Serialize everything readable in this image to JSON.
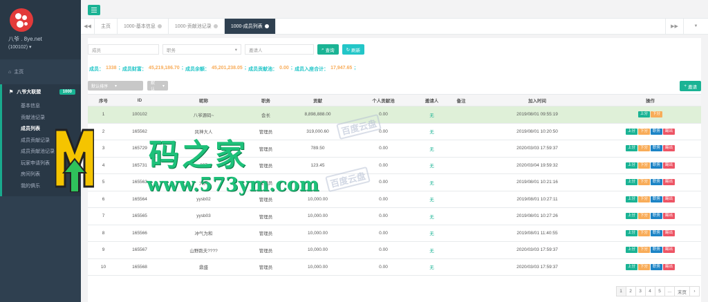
{
  "sidebar": {
    "brand": "八爷 . 8ye.net",
    "user_id": "(100102)",
    "home": "主页",
    "group": {
      "label": "八爷大联盟",
      "badge": "1000"
    },
    "items": [
      {
        "label": "基本信息"
      },
      {
        "label": "贡献池记录"
      },
      {
        "label": "成员列表"
      },
      {
        "label": "成员贡献记录"
      },
      {
        "label": "成员贡献池记录"
      },
      {
        "label": "玩家申请列表"
      },
      {
        "label": "房间列表"
      },
      {
        "label": "我的俱乐"
      }
    ]
  },
  "tabs": [
    {
      "label": "主页"
    },
    {
      "label": "1000-基本信息"
    },
    {
      "label": "1000-贡献池记录"
    },
    {
      "label": "1000-成员列表"
    }
  ],
  "filters": {
    "member_placeholder": "成员",
    "role_placeholder": "职务",
    "inviter_placeholder": "邀请人",
    "search": "查询",
    "refresh": "刷新"
  },
  "stats": {
    "members_label": "成员：",
    "members": "1338",
    "wealth_label": "成员财富：",
    "wealth": "45,219,186.70",
    "balance_label": "成员余额：",
    "balance": "45,201,238.05",
    "contrib_label": "成员贡献池：",
    "contrib": "0.00",
    "seat_label": "成员入座合计：",
    "seat": "17,947.65"
  },
  "toolbar": {
    "sort": "默认排序",
    "default": "默认",
    "add": "邀请"
  },
  "table": {
    "headers": [
      "序号",
      "ID",
      "昵称",
      "职务",
      "贡献",
      "个人贡献池",
      "邀请人",
      "备注",
      "加入时间",
      "操作"
    ],
    "rows": [
      {
        "idx": "1",
        "id": "100102",
        "nick": "八爷源码~",
        "role": "会长",
        "contrib": "8,898,888.00",
        "pool": "0.00",
        "ref": "无",
        "note": "",
        "time": "2019/08/01 09:55:19"
      },
      {
        "idx": "2",
        "id": "165562",
        "nick": "风神大人",
        "role": "管理员",
        "contrib": "319,000.60",
        "pool": "0.00",
        "ref": "无",
        "note": "",
        "time": "2019/08/01 10:20:50"
      },
      {
        "idx": "3",
        "id": "165729",
        "nick": "111",
        "role": "管理员",
        "contrib": "789.50",
        "pool": "0.00",
        "ref": "无",
        "note": "",
        "time": "2020/03/03 17:59:37"
      },
      {
        "idx": "4",
        "id": "165731",
        "nick": "007",
        "role": "管理员",
        "contrib": "123.45",
        "pool": "0.00",
        "ref": "无",
        "note": "",
        "time": "2020/03/04 19:59:32"
      },
      {
        "idx": "5",
        "id": "165563",
        "nick": "大天",
        "role": "管理员",
        "contrib": "",
        "pool": "0.00",
        "ref": "无",
        "note": "",
        "time": "2019/08/01 10:21:16"
      },
      {
        "idx": "6",
        "id": "165564",
        "nick": "yysb02",
        "role": "管理员",
        "contrib": "10,000.00",
        "pool": "0.00",
        "ref": "无",
        "note": "",
        "time": "2019/08/01 10:27:11"
      },
      {
        "idx": "7",
        "id": "165565",
        "nick": "yysb03",
        "role": "管理员",
        "contrib": "10,000.00",
        "pool": "0.00",
        "ref": "无",
        "note": "",
        "time": "2019/08/01 10:27:26"
      },
      {
        "idx": "8",
        "id": "165566",
        "nick": "冲气为和",
        "role": "管理员",
        "contrib": "10,000.00",
        "pool": "0.00",
        "ref": "无",
        "note": "",
        "time": "2019/08/01 11:40:55"
      },
      {
        "idx": "9",
        "id": "165567",
        "nick": "山野跑夫????",
        "role": "管理员",
        "contrib": "10,000.00",
        "pool": "0.00",
        "ref": "无",
        "note": "",
        "time": "2020/03/03 17:59:37"
      },
      {
        "idx": "10",
        "id": "165568",
        "nick": "鼎盛",
        "role": "管理员",
        "contrib": "10,000.00",
        "pool": "0.00",
        "ref": "无",
        "note": "",
        "time": "2020/03/03 17:59:37"
      }
    ],
    "ops": {
      "up": "上分",
      "down": "下分",
      "role": "职务",
      "kick": "踢出"
    }
  },
  "pagination": {
    "pages": [
      "1",
      "2",
      "3",
      "4",
      "5"
    ],
    "more": "...",
    "last": "末页"
  },
  "watermark": {
    "title": "码之家",
    "url": "www.573ym.com",
    "faint": "百度云盘"
  },
  "colors": {
    "accent": "#1ab394",
    "sidebar": "#2f4050",
    "highlight_row": "#dff0d8",
    "warning": "#f8ac59",
    "danger": "#ed5565",
    "primary": "#1c84c6"
  }
}
